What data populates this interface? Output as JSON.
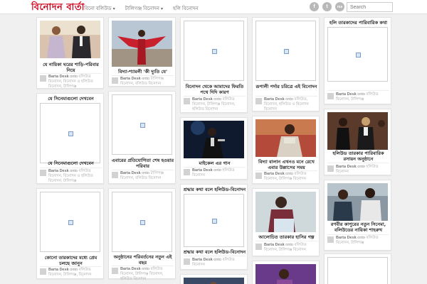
{
  "header": {
    "logo": "বিনোদন বার্তা",
    "nav": [
      {
        "label": "বিনো বলিউড",
        "dropdown": true
      },
      {
        "label": "টালিগঞ্জ বিনোদন",
        "dropdown": true
      },
      {
        "label": "হলি বিনোদন",
        "dropdown": false
      }
    ],
    "social": [
      "f",
      "t",
      "rss"
    ],
    "search_placeholder": "Search"
  },
  "posts": [
    {
      "title": "যে নায়িকা ঘরের শাড়ি-পরিবার নিয়ে",
      "author": "Barta Desk",
      "by": "onto",
      "cats": "বলিউড বিনোদন, বিনোদন ও হলিউড বিনোদন, টালিগঞ্জ"
    },
    {
      "title": "বিদ্যা-শ্যামলী 'কী দ্যুতি যে'",
      "author": "Barta Desk",
      "by": "onto",
      "cats": "টালিগঞ্জ বিনোদন, বলিউড বিনোদন"
    },
    {
      "title": "বিনোদন থেকে আমাদের ফিরতি পথে দিদি কারণ",
      "author": "Barta Desk",
      "by": "onto",
      "cats": "বলিউড বিনোদন, টালিগঞ্জ বিনোদন, হলিউড বিনোদন"
    },
    {
      "title": "রূপালী পর্দার চরিত্রে এই বিনোদন",
      "author": "Barta Desk",
      "by": "onto",
      "cats": "বলিউড, বিনোদন, হলিউড ও বিনোদন বিনোদন"
    },
    {
      "title": "হলি তারকাদের পারিবারিক কথা",
      "author": "Barta Desk",
      "by": "onto",
      "cats": "বলিউড বিনোদন, টালিগঞ্জ"
    },
    {
      "title": "যে সিনেমাগুলো দেখবেন",
      "author": "Barta Desk",
      "by": "onto",
      "cats": "বলিউড বিনোদন, বিনোদন ও হলিউড বিনোদন, টালিগঞ্জ"
    },
    {
      "title": "এবারের প্রতিযোগিতা শেষ হওয়ার পরিবার",
      "author": "Barta Desk",
      "by": "onto",
      "cats": "টালিগঞ্জ বিনোদন, বলিউড বিনোদন"
    },
    {
      "title": "মাইকেল এর গান",
      "author": "Barta Desk",
      "by": "onto",
      "cats": "হলিউড বিনোদন"
    },
    {
      "title": "বিদ্যা বালান এখনও মনে রেখে এবার উল্লাসের সময়",
      "author": "Barta Desk",
      "by": "onto",
      "cats": "বলিউড বিনোদন, টালিগঞ্জ বিনোদন"
    },
    {
      "title": "হলিউড তারকার পারিবারিক রসায়ন অনুষ্ঠানে",
      "author": "Barta Desk",
      "by": "onto",
      "cats": "হলিউড বিনোদন"
    },
    {
      "title": "কোনো তারকাদের মধ্যে প্রেম চলছে জানুন",
      "author": "Barta Desk",
      "by": "onto",
      "cats": "বলিউড বিনোদন, টালিগঞ্জ, বিনোদন"
    },
    {
      "title": "অনুষ্ঠানের পরিবর্তনের নতুন এই বছর",
      "author": "Barta Desk",
      "by": "onto",
      "cats": "বলিউড বিনোদন, টালিগঞ্জ বিনোদন, হলিউড বিনোদন"
    },
    {
      "title": "শ্রদ্ধার কথা বলে হলিউড-বিনোদন",
      "author": "Barta Desk",
      "by": "onto",
      "cats": "বলিউড বিনোদন"
    },
    {
      "title": "আলোচিত তারকার হাসির গল্প",
      "author": "Barta Desk",
      "by": "onto",
      "cats": "বলিউড বিনোদন, টালিগঞ্জ বিনোদন"
    },
    {
      "title": "রণবীর কাপুরের নতুন সিনেমা, বলিউডের নায়িকা শাহরুখ",
      "author": "Barta Desk",
      "by": "onto",
      "cats": "বলিউড বিনোদন, টালিগঞ্জ"
    }
  ]
}
